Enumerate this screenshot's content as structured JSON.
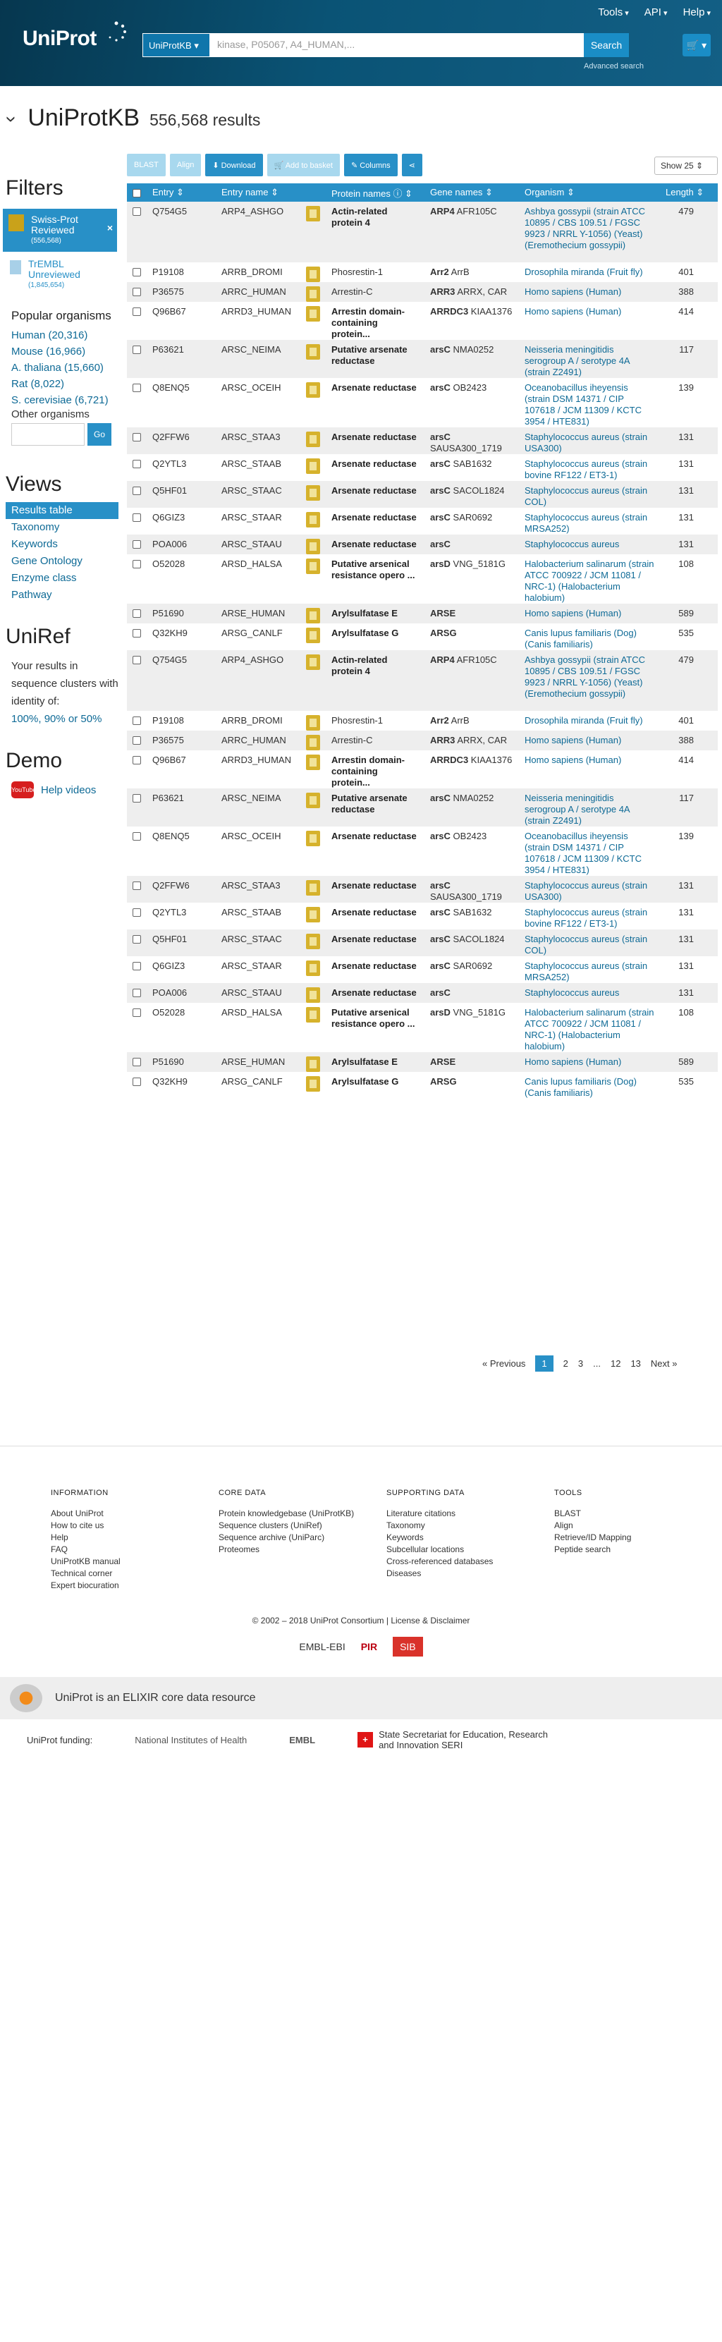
{
  "header": {
    "logo": "UniProt",
    "tools": "Tools",
    "api": "API",
    "help": "Help",
    "search_db": "UniProtKB",
    "search_placeholder": "kinase, P05067, A4_HUMAN,...",
    "search_button": "Search",
    "advanced": "Advanced search"
  },
  "title": {
    "db": "UniProtKB",
    "count": "556,568 results"
  },
  "sidebar": {
    "filters": "Filters",
    "swissprot": "Swiss-Prot Reviewed",
    "swissprot_count": "(556,568)",
    "trembl": "TrEMBL Unreviewed",
    "trembl_count": "(1,845,654)",
    "popular": "Popular organisms",
    "orgs": [
      "Human (20,316)",
      "Mouse (16,966)",
      "A. thaliana (15,660)",
      "Rat (8,022)",
      "S. cerevisiae (6,721)"
    ],
    "other": "Other organisms",
    "go": "Go",
    "views": "Views",
    "view_items": [
      "Results table",
      "Taxonomy",
      "Keywords",
      "Gene Ontology",
      "Enzyme class",
      "Pathway"
    ],
    "uniref": "UniRef",
    "uniref_text": "Your results in sequence clusters with identity of:",
    "uniref_links": "100%, 90% or 50%",
    "demo": "Demo",
    "help_videos": "Help videos",
    "youtube": "YouTube"
  },
  "toolbar": {
    "blast": "BLAST",
    "align": "Align",
    "download": "Download",
    "basket": "Add to basket",
    "columns": "Columns",
    "show": "Show 25"
  },
  "columns": [
    "Entry",
    "Entry name",
    "Protein names",
    "Gene names",
    "Organism",
    "Length"
  ],
  "rows": [
    {
      "e": "Q754G5",
      "n": "ARP4_ASHGO",
      "p": "Actin-related protein 4",
      "pb": true,
      "g": "ARP4",
      "g2": "AFR105C",
      "o": "Ashbya gossypii (strain ATCC 10895 / CBS 109.51 / FGSC 9923 / NRRL Y-1056) (Yeast) (Eremothecium gossypii)",
      "l": "479"
    },
    {
      "e": "P19108",
      "n": "ARRB_DROMI",
      "p": "Phosrestin-1",
      "pb": false,
      "g": "Arr2",
      "g2": "ArrB",
      "o": "Drosophila miranda (Fruit fly)",
      "l": "401"
    },
    {
      "e": "P36575",
      "n": "ARRC_HUMAN",
      "p": "Arrestin-C",
      "pb": false,
      "g": "ARR3",
      "g2": "ARRX, CAR",
      "o": "Homo sapiens (Human)",
      "l": "388"
    },
    {
      "e": "Q96B67",
      "n": "ARRD3_HUMAN",
      "p": "Arrestin domain-containing protein...",
      "pb": true,
      "g": "ARRDC3",
      "g2": "KIAA1376",
      "o": "Homo sapiens (Human)",
      "l": "414"
    },
    {
      "e": "P63621",
      "n": "ARSC_NEIMA",
      "p": "Putative arsenate reductase",
      "pb": true,
      "g": "arsC",
      "g2": "NMA0252",
      "o": "Neisseria meningitidis serogroup A / serotype 4A (strain Z2491)",
      "l": "117"
    },
    {
      "e": "Q8ENQ5",
      "n": "ARSC_OCEIH",
      "p": "Arsenate reductase",
      "pb": true,
      "g": "arsC",
      "g2": "OB2423",
      "o": "Oceanobacillus iheyensis (strain DSM 14371 / CIP 107618 / JCM 11309 / KCTC 3954 / HTE831)",
      "l": "139"
    },
    {
      "e": "Q2FFW6",
      "n": "ARSC_STAA3",
      "p": "Arsenate reductase",
      "pb": true,
      "g": "arsC",
      "g2": "SAUSA300_1719",
      "o": "Staphylococcus aureus (strain USA300)",
      "l": "131"
    },
    {
      "e": "Q2YTL3",
      "n": "ARSC_STAAB",
      "p": "Arsenate reductase",
      "pb": true,
      "g": "arsC",
      "g2": "SAB1632",
      "o": "Staphylococcus aureus (strain bovine RF122 / ET3-1)",
      "l": "131"
    },
    {
      "e": "Q5HF01",
      "n": "ARSC_STAAC",
      "p": "Arsenate reductase",
      "pb": true,
      "g": "arsC",
      "g2": "SACOL1824",
      "o": "Staphylococcus aureus (strain COL)",
      "l": "131"
    },
    {
      "e": "Q6GIZ3",
      "n": "ARSC_STAAR",
      "p": "Arsenate reductase",
      "pb": true,
      "g": "arsC",
      "g2": "SAR0692",
      "o": "Staphylococcus aureus (strain MRSA252)",
      "l": "131"
    },
    {
      "e": "POA006",
      "n": "ARSC_STAAU",
      "p": "Arsenate reductase",
      "pb": true,
      "g": "arsC",
      "g2": "",
      "o": "Staphylococcus aureus",
      "l": "131"
    },
    {
      "e": "O52028",
      "n": "ARSD_HALSA",
      "p": "Putative arsenical resistance opero ...",
      "pb": true,
      "g": "arsD",
      "g2": "VNG_5181G",
      "o": "Halobacterium salinarum (strain ATCC 700922 / JCM 11081 / NRC-1) (Halobacterium halobium)",
      "l": "108"
    },
    {
      "e": "P51690",
      "n": "ARSE_HUMAN",
      "p": "Arylsulfatase E",
      "pb": true,
      "g": "ARSE",
      "g2": "",
      "o": "Homo sapiens (Human)",
      "l": "589"
    },
    {
      "e": "Q32KH9",
      "n": "ARSG_CANLF",
      "p": "Arylsulfatase G",
      "pb": true,
      "g": "ARSG",
      "g2": "",
      "o": "Canis lupus familiaris (Dog) (Canis familiaris)",
      "l": "535"
    },
    {
      "e": "Q754G5",
      "n": "ARP4_ASHGO",
      "p": "Actin-related protein 4",
      "pb": true,
      "g": "ARP4",
      "g2": "AFR105C",
      "o": "Ashbya gossypii (strain ATCC 10895 / CBS 109.51 / FGSC 9923 / NRRL Y-1056) (Yeast) (Eremothecium gossypii)",
      "l": "479"
    },
    {
      "e": "P19108",
      "n": "ARRB_DROMI",
      "p": "Phosrestin-1",
      "pb": false,
      "g": "Arr2",
      "g2": "ArrB",
      "o": "Drosophila miranda (Fruit fly)",
      "l": "401"
    },
    {
      "e": "P36575",
      "n": "ARRC_HUMAN",
      "p": "Arrestin-C",
      "pb": false,
      "g": "ARR3",
      "g2": "ARRX, CAR",
      "o": "Homo sapiens (Human)",
      "l": "388"
    },
    {
      "e": "Q96B67",
      "n": "ARRD3_HUMAN",
      "p": "Arrestin domain-containing protein...",
      "pb": true,
      "g": "ARRDC3",
      "g2": "KIAA1376",
      "o": "Homo sapiens (Human)",
      "l": "414"
    },
    {
      "e": "P63621",
      "n": "ARSC_NEIMA",
      "p": "Putative arsenate reductase",
      "pb": true,
      "g": "arsC",
      "g2": "NMA0252",
      "o": "Neisseria meningitidis serogroup A / serotype 4A (strain Z2491)",
      "l": "117"
    },
    {
      "e": "Q8ENQ5",
      "n": "ARSC_OCEIH",
      "p": "Arsenate reductase",
      "pb": true,
      "g": "arsC",
      "g2": "OB2423",
      "o": "Oceanobacillus iheyensis (strain DSM 14371 / CIP 107618 / JCM 11309 / KCTC 3954 / HTE831)",
      "l": "139"
    },
    {
      "e": "Q2FFW6",
      "n": "ARSC_STAA3",
      "p": "Arsenate reductase",
      "pb": true,
      "g": "arsC",
      "g2": "SAUSA300_1719",
      "o": "Staphylococcus aureus (strain USA300)",
      "l": "131"
    },
    {
      "e": "Q2YTL3",
      "n": "ARSC_STAAB",
      "p": "Arsenate reductase",
      "pb": true,
      "g": "arsC",
      "g2": "SAB1632",
      "o": "Staphylococcus aureus (strain bovine RF122 / ET3-1)",
      "l": "131"
    },
    {
      "e": "Q5HF01",
      "n": "ARSC_STAAC",
      "p": "Arsenate reductase",
      "pb": true,
      "g": "arsC",
      "g2": "SACOL1824",
      "o": "Staphylococcus aureus (strain COL)",
      "l": "131"
    },
    {
      "e": "Q6GIZ3",
      "n": "ARSC_STAAR",
      "p": "Arsenate reductase",
      "pb": true,
      "g": "arsC",
      "g2": "SAR0692",
      "o": "Staphylococcus aureus (strain MRSA252)",
      "l": "131"
    },
    {
      "e": "POA006",
      "n": "ARSC_STAAU",
      "p": "Arsenate reductase",
      "pb": true,
      "g": "arsC",
      "g2": "",
      "o": "Staphylococcus aureus",
      "l": "131"
    },
    {
      "e": "O52028",
      "n": "ARSD_HALSA",
      "p": "Putative arsenical resistance opero ...",
      "pb": true,
      "g": "arsD",
      "g2": "VNG_5181G",
      "o": "Halobacterium salinarum (strain ATCC 700922 / JCM 11081 / NRC-1) (Halobacterium halobium)",
      "l": "108"
    },
    {
      "e": "P51690",
      "n": "ARSE_HUMAN",
      "p": "Arylsulfatase E",
      "pb": true,
      "g": "ARSE",
      "g2": "",
      "o": "Homo sapiens (Human)",
      "l": "589"
    },
    {
      "e": "Q32KH9",
      "n": "ARSG_CANLF",
      "p": "Arylsulfatase G",
      "pb": true,
      "g": "ARSG",
      "g2": "",
      "o": "Canis lupus familiaris (Dog) (Canis familiaris)",
      "l": "535"
    }
  ],
  "pagination": {
    "prev": "« Previous",
    "pages": [
      "1",
      "2",
      "3",
      "...",
      "12",
      "13"
    ],
    "next": "Next »"
  },
  "footer": {
    "cols": [
      {
        "h": "INFORMATION",
        "items": [
          "About UniProt",
          "How to cite us",
          "Help",
          "FAQ",
          "UniProtKB manual",
          "Technical corner",
          "Expert biocuration"
        ]
      },
      {
        "h": "CORE DATA",
        "items": [
          "Protein knowledgebase (UniProtKB)",
          "Sequence clusters (UniRef)",
          "Sequence archive (UniParc)",
          "Proteomes"
        ]
      },
      {
        "h": "SUPPORTING DATA",
        "items": [
          "Literature citations",
          "Taxonomy",
          "Keywords",
          "Subcellular locations",
          "Cross-referenced databases",
          "Diseases"
        ]
      },
      {
        "h": "TOOLS",
        "items": [
          "BLAST",
          "Align",
          "Retrieve/ID Mapping",
          "Peptide search"
        ]
      }
    ],
    "copyright": "© 2002 – 2018 UniProt Consortium | License & Disclaimer",
    "logos": [
      "EMBL-EBI",
      "PIR",
      "SIB"
    ],
    "elixir": "UniProt is an ELIXIR core data resource",
    "funding_label": "UniProt funding:",
    "nih": "National Institutes of Health",
    "embl": "EMBL",
    "seri": "State Secretariat for Education, Research and Innovation SERI"
  }
}
